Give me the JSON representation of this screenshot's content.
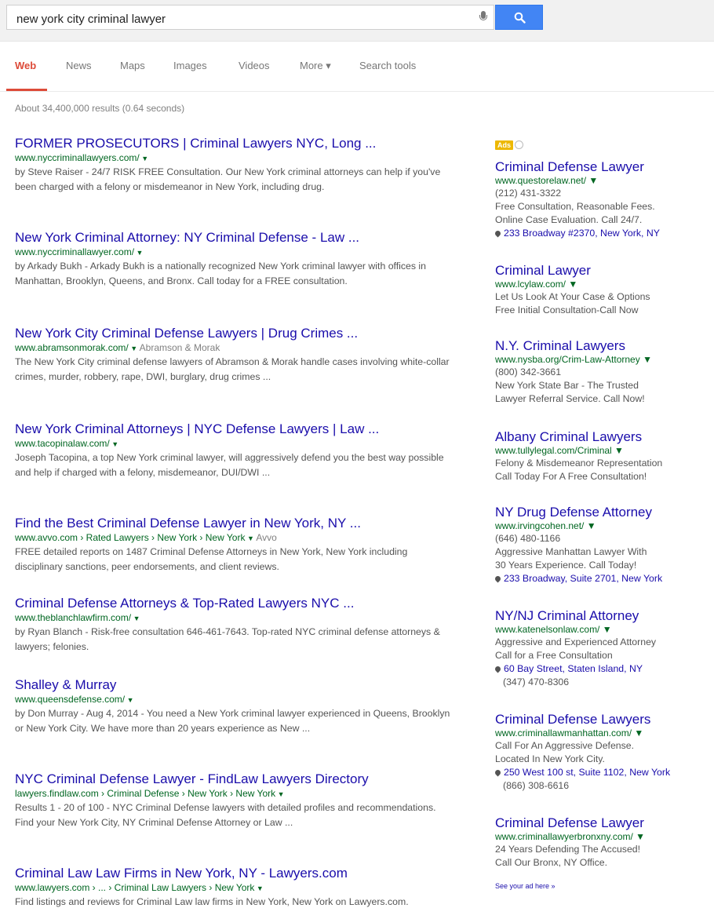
{
  "search": {
    "query": "new york city criminal lawyer"
  },
  "tabs": [
    "Web",
    "News",
    "Maps",
    "Images",
    "Videos",
    "More ▾",
    "Search tools"
  ],
  "stats": "About 34,400,000 results (0.64 seconds)",
  "results": [
    {
      "title": "FORMER PROSECUTORS | Criminal Lawyers NYC, Long ...",
      "url": "www.nyccriminallawyers.com/",
      "snippet": "by Steve Raiser - 24/7 RISK FREE Consultation. Our New York criminal attorneys can help if you've been charged with a felony or misdemeanor in New York, including drug."
    },
    {
      "title": "New York Criminal Attorney: NY Criminal Defense - Law ...",
      "url": "www.nyccriminallawyer.com/",
      "snippet": "by Arkady Bukh - Arkady Bukh is a nationally recognized New York criminal lawyer with offices in Manhattan, Brooklyn, Queens, and Bronx. Call today for a FREE consultation."
    },
    {
      "title": "New York City Criminal Defense Lawyers | Drug Crimes ...",
      "url": "www.abramsonmorak.com/",
      "url_extra": "Abramson & Morak",
      "snippet": "The New York City criminal defense lawyers of Abramson & Morak handle cases involving white-collar crimes, murder, robbery, rape, DWI, burglary, drug crimes ..."
    },
    {
      "title": "New York Criminal Attorneys | NYC Defense Lawyers | Law ...",
      "url": "www.tacopinalaw.com/",
      "snippet": "Joseph Tacopina, a top New York criminal lawyer, will aggressively defend you the best way possible and help if charged with a felony, misdemeanor, DUI/DWI ..."
    },
    {
      "title": "Find the Best Criminal Defense Lawyer in New York, NY ...",
      "url": "www.avvo.com › Rated Lawyers › New York › New York",
      "url_extra": "Avvo",
      "snippet": "FREE detailed reports on 1487 Criminal Defense Attorneys in New York, New York including disciplinary sanctions, peer endorsements, and client reviews."
    },
    {
      "title": "Criminal Defense Attorneys & Top-Rated Lawyers NYC ...",
      "url": "www.theblanchlawfirm.com/",
      "snippet": "by Ryan Blanch - Risk-free consultation 646-461-7643. Top-rated NYC criminal defense attorneys & lawyers; felonies."
    },
    {
      "title": "Shalley & Murray",
      "url": "www.queensdefense.com/",
      "snippet": "by Don Murray - Aug 4, 2014 - You need a New York criminal lawyer experienced in Queens, Brooklyn or New York City. We have more than 20 years experience as New ..."
    },
    {
      "title": "NYC Criminal Defense Lawyer - FindLaw Lawyers Directory",
      "url": "lawyers.findlaw.com › Criminal Defense › New York › New York",
      "snippet": "Results 1 - 20 of 100 - NYC Criminal Defense lawyers with detailed profiles and recommendations. Find your New York City, NY Criminal Defense Attorney or Law ..."
    },
    {
      "title": "Criminal Law Law Firms in New York, NY - Lawyers.com",
      "url": "www.lawyers.com › ... › Criminal Law Lawyers › New York",
      "snippet": "Find listings and reviews for Criminal Law law firms in New York, New York on Lawyers.com."
    }
  ],
  "ads_badge": "Ads",
  "ads": [
    {
      "title": "Criminal Defense Lawyer",
      "url": "www.questorelaw.net/",
      "lines": [
        "(212) 431-3322",
        "Free Consultation, Reasonable Fees.",
        "Online Case Evaluation. Call 24/7."
      ],
      "location": "233 Broadway #2370, New York, NY"
    },
    {
      "title": "Criminal Lawyer",
      "url": "www.lcylaw.com/",
      "lines": [
        "Let Us Look At Your Case & Options",
        "Free Initial Consultation-Call Now"
      ]
    },
    {
      "title": "N.Y. Criminal Lawyers",
      "url": "www.nysba.org/Crim-Law-Attorney",
      "lines": [
        "(800) 342-3661",
        "New York State Bar - The Trusted",
        "Lawyer Referral Service. Call Now!"
      ]
    },
    {
      "title": "Albany Criminal Lawyers",
      "url": "www.tullylegal.com/Criminal",
      "lines": [
        "Felony & Misdemeanor Representation",
        "Call Today For A Free Consultation!"
      ]
    },
    {
      "title": "NY Drug Defense Attorney",
      "url": "www.irvingcohen.net/",
      "lines": [
        "(646) 480-1166",
        "Aggressive Manhattan Lawyer With",
        "30 Years Experience. Call Today!"
      ],
      "location": "233 Broadway, Suite 2701, New York"
    },
    {
      "title": "NY/NJ Criminal Attorney",
      "url": "www.katenelsonlaw.com/",
      "lines": [
        "Aggressive and Experienced Attorney",
        "Call for a Free Consultation"
      ],
      "location": "60 Bay Street, Staten Island, NY",
      "after": "(347) 470-8306"
    },
    {
      "title": "Criminal Defense Lawyers",
      "url": "www.criminallawmanhattan.com/",
      "lines": [
        "Call For An Aggressive Defense.",
        "Located In New York City."
      ],
      "location": "250 West 100 st, Suite 1102, New York",
      "after": "(866) 308-6616"
    },
    {
      "title": "Criminal Defense Lawyer",
      "url": "www.criminallawyerbronxny.com/",
      "lines": [
        "24 Years Defending The Accused!",
        "Call Our Bronx, NY Office."
      ]
    }
  ],
  "see_ad": "See your ad here »",
  "colors": {
    "link": "#1a0dab",
    "url": "#006621",
    "snippet": "#545454",
    "active_tab": "#dd4b39",
    "search_button": "#4285f4",
    "ad_badge": "#edb802"
  }
}
